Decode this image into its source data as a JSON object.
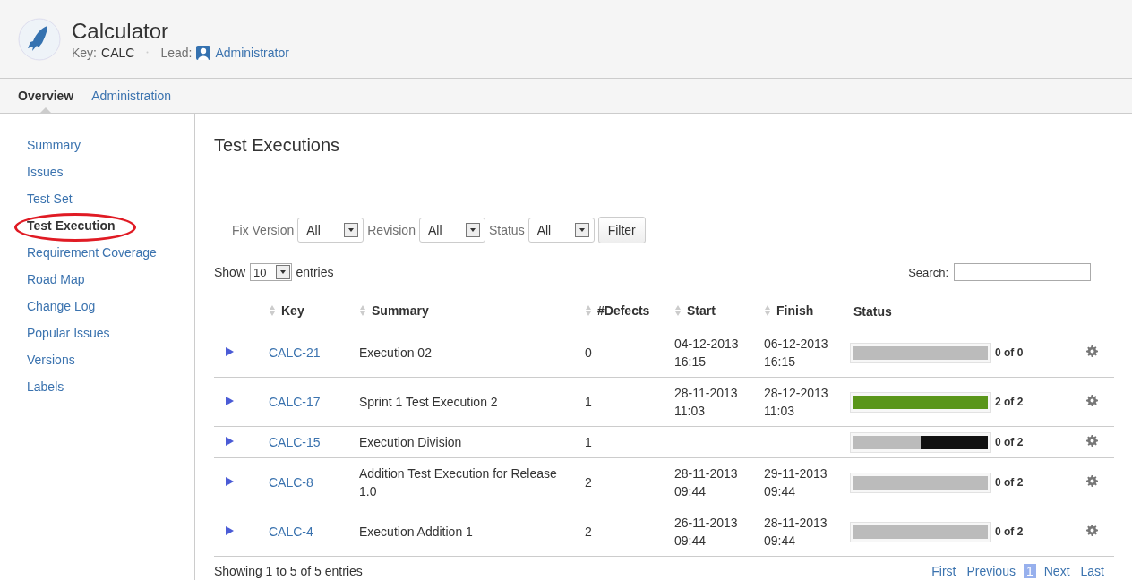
{
  "project": {
    "name": "Calculator",
    "key_label": "Key:",
    "key": "CALC",
    "lead_label": "Lead:",
    "lead": "Administrator"
  },
  "tabs": [
    {
      "label": "Overview",
      "selected": true
    },
    {
      "label": "Administration",
      "selected": false
    }
  ],
  "sidebar": {
    "items": [
      {
        "label": "Summary",
        "selected": false,
        "circled": false
      },
      {
        "label": "Issues",
        "selected": false,
        "circled": false
      },
      {
        "label": "Test Set",
        "selected": false,
        "circled": false
      },
      {
        "label": "Test Execution",
        "selected": true,
        "circled": true
      },
      {
        "label": "Requirement Coverage",
        "selected": false,
        "circled": false
      },
      {
        "label": "Road Map",
        "selected": false,
        "circled": false
      },
      {
        "label": "Change Log",
        "selected": false,
        "circled": false
      },
      {
        "label": "Popular Issues",
        "selected": false,
        "circled": false
      },
      {
        "label": "Versions",
        "selected": false,
        "circled": false
      },
      {
        "label": "Labels",
        "selected": false,
        "circled": false
      }
    ]
  },
  "main": {
    "title": "Test Executions",
    "filters": [
      {
        "label": "Fix Version",
        "value": "All"
      },
      {
        "label": "Revision",
        "value": "All"
      },
      {
        "label": "Status",
        "value": "All"
      }
    ],
    "filter_button": "Filter",
    "show_label": "Show",
    "page_size": "10",
    "entries_label": "entries",
    "search_label": "Search:",
    "table": {
      "columns": [
        {
          "label": "Key",
          "sortable": true
        },
        {
          "label": "Summary",
          "sortable": true
        },
        {
          "label": "#Defects",
          "sortable": true
        },
        {
          "label": "Start",
          "sortable": true
        },
        {
          "label": "Finish",
          "sortable": true
        },
        {
          "label": "Status",
          "sortable": false
        }
      ],
      "rows": [
        {
          "key": "CALC-21",
          "summary": "Execution 02",
          "defects": "0",
          "start": "04-12-2013 16:15",
          "finish": "06-12-2013 16:15",
          "segments": [
            {
              "color": "#bbbbbb",
              "level": 1
            }
          ],
          "count": "0 of 0"
        },
        {
          "key": "CALC-17",
          "summary": "Sprint 1 Test Execution 2",
          "defects": "1",
          "start": "28-11-2013 11:03",
          "finish": "28-12-2013 11:03",
          "segments": [
            {
              "color": "#5a961a",
              "level": 1
            }
          ],
          "count": "2 of 2"
        },
        {
          "key": "CALC-15",
          "summary": "Execution Division",
          "defects": "1",
          "segments": [
            {
              "color": "#bbbbbb",
              "level": 0.5
            },
            {
              "color": "#111111",
              "level": 0.5
            }
          ],
          "count": "0 of 2"
        },
        {
          "key": "CALC-8",
          "summary": "Addition Test Execution for Release 1.0",
          "defects": "2",
          "start": "28-11-2013 09:44",
          "finish": "29-11-2013 09:44",
          "segments": [
            {
              "color": "#bbbbbb",
              "level": 1
            }
          ],
          "count": "0 of 2"
        },
        {
          "key": "CALC-4",
          "summary": "Execution Addition 1",
          "defects": "2",
          "start": "26-11-2013 09:44",
          "finish": "28-11-2013 09:44",
          "segments": [
            {
              "color": "#bbbbbb",
              "level": 1
            }
          ],
          "count": "0 of 2"
        }
      ]
    },
    "info": "Showing 1 to 5 of 5 entries",
    "pagination": [
      {
        "label": "First",
        "selected": false
      },
      {
        "label": "Previous",
        "selected": false
      },
      {
        "label": "1",
        "selected": true
      },
      {
        "label": "Next",
        "selected": false
      },
      {
        "label": "Last",
        "selected": false
      }
    ]
  }
}
